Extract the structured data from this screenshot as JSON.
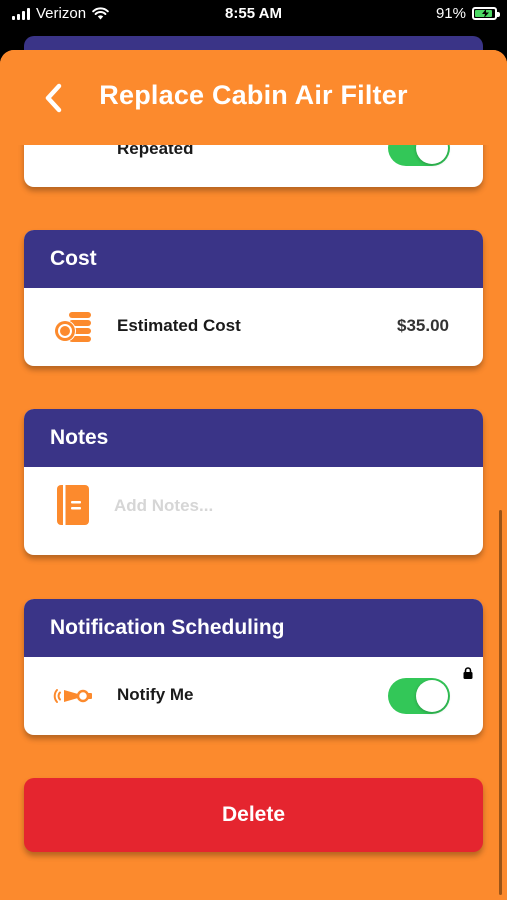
{
  "status_bar": {
    "carrier": "Verizon",
    "time": "8:55 AM",
    "battery": "91%",
    "battery_level": 0.91
  },
  "header": {
    "title": "Replace Cabin Air Filter",
    "back_icon": "chevron-left-icon"
  },
  "repeat_card": {
    "label": "Repeated",
    "toggle_on": true
  },
  "cost_card": {
    "title": "Cost",
    "label": "Estimated Cost",
    "value": "$35.00",
    "icon": "coins-icon"
  },
  "notes_card": {
    "title": "Notes",
    "placeholder": "Add Notes...",
    "value": "",
    "icon": "notebook-icon"
  },
  "notification_card": {
    "title": "Notification Scheduling",
    "label": "Notify Me",
    "toggle_on": true,
    "icon": "horn-icon",
    "lock_icon": "lock-icon"
  },
  "delete_label": "Delete",
  "colors": {
    "accent_orange": "#fc8a2d",
    "header_purple": "#3a3487",
    "toggle_green": "#33c758",
    "delete_red": "#e5252f"
  }
}
